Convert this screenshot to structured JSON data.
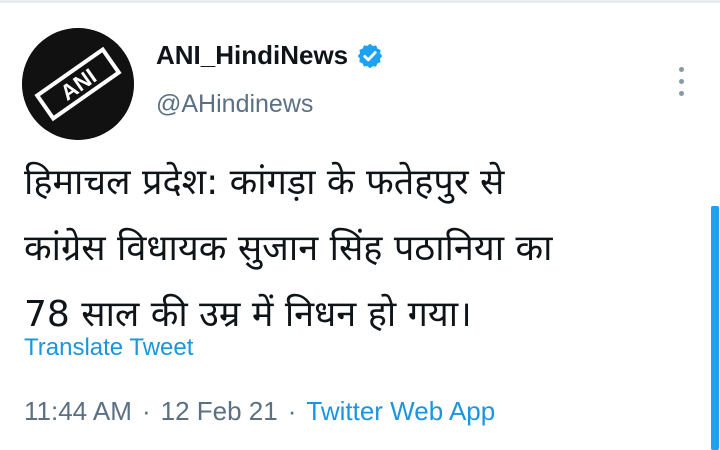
{
  "tweet": {
    "display_name": "ANI_HindiNews",
    "handle": "@AHindinews",
    "avatar_logo_text": "ANI",
    "text_lines": [
      "हिमाचल प्रदेश: कांगड़ा के फतेहपुर से",
      "कांग्रेस विधायक सुजान सिंह पठानिया का",
      "78 साल की उम्र में निधन हो गया।"
    ],
    "translate_label": "Translate Tweet",
    "time": "11:44 AM",
    "date": "12 Feb 21",
    "separator": "·",
    "source_app": "Twitter Web App"
  },
  "icons": {
    "verified": "verified-badge-icon",
    "more": "more-vertical-icon"
  },
  "colors": {
    "link": "#1b95e0",
    "verified": "#1da1f2",
    "secondary_text": "#5b7083",
    "primary_text": "#0f1419"
  }
}
